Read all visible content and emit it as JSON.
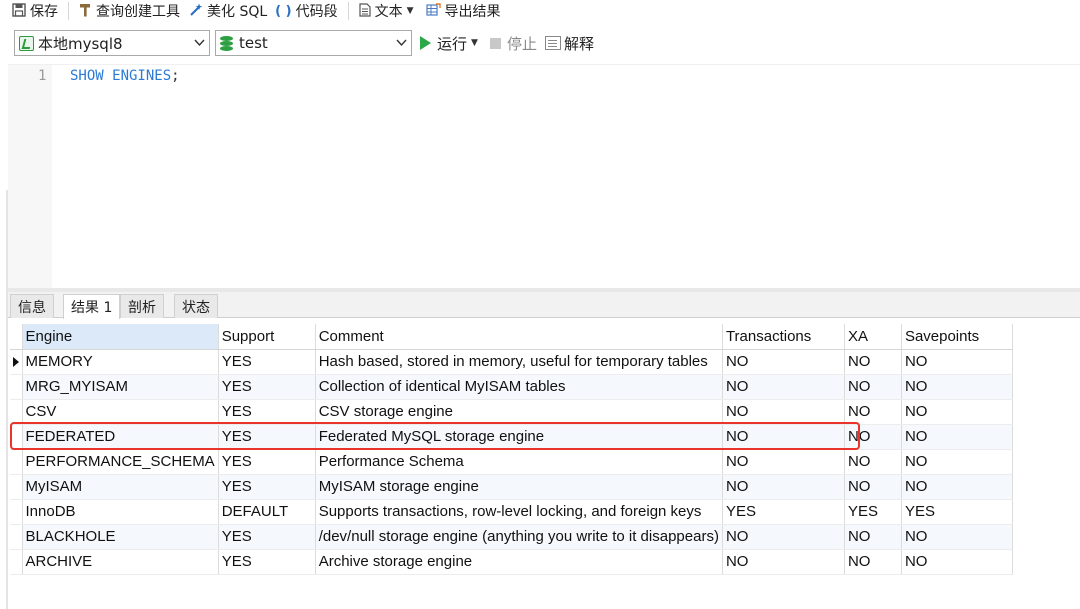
{
  "toolbar": {
    "save": "保存",
    "query_builder": "查询创建工具",
    "beautify": "美化 SQL",
    "snippet": "代码段",
    "text": "文本",
    "export": "导出结果"
  },
  "connection": {
    "selected_connection": "本地mysql8",
    "selected_database": "test",
    "run": "运行",
    "stop": "停止",
    "explain": "解释"
  },
  "editor": {
    "line_number": "1",
    "code_keyword": "SHOW ENGINES",
    "code_punct": ";"
  },
  "result_tabs": [
    {
      "label": "信息"
    },
    {
      "label": "结果 1"
    },
    {
      "label": "剖析"
    },
    {
      "label": "状态"
    }
  ],
  "grid": {
    "columns": [
      "Engine",
      "Support",
      "Comment",
      "Transactions",
      "XA",
      "Savepoints"
    ],
    "rows": [
      [
        "MEMORY",
        "YES",
        "Hash based, stored in memory, useful for temporary tables",
        "NO",
        "NO",
        "NO"
      ],
      [
        "MRG_MYISAM",
        "YES",
        "Collection of identical MyISAM tables",
        "NO",
        "NO",
        "NO"
      ],
      [
        "CSV",
        "YES",
        "CSV storage engine",
        "NO",
        "NO",
        "NO"
      ],
      [
        "FEDERATED",
        "YES",
        "Federated MySQL storage engine",
        "NO",
        "NO",
        "NO"
      ],
      [
        "PERFORMANCE_SCHEMA",
        "YES",
        "Performance Schema",
        "NO",
        "NO",
        "NO"
      ],
      [
        "MyISAM",
        "YES",
        "MyISAM storage engine",
        "NO",
        "NO",
        "NO"
      ],
      [
        "InnoDB",
        "DEFAULT",
        "Supports transactions, row-level locking, and foreign keys",
        "YES",
        "YES",
        "YES"
      ],
      [
        "BLACKHOLE",
        "YES",
        "/dev/null storage engine (anything you write to it disappears)",
        "NO",
        "NO",
        "NO"
      ],
      [
        "ARCHIVE",
        "YES",
        "Archive storage engine",
        "NO",
        "NO",
        "NO"
      ]
    ]
  },
  "colors": {
    "highlight": "#e8342b",
    "keyword": "#2a7ad4",
    "run_green": "#2aa84a",
    "header_selected": "#dbe9f8"
  }
}
